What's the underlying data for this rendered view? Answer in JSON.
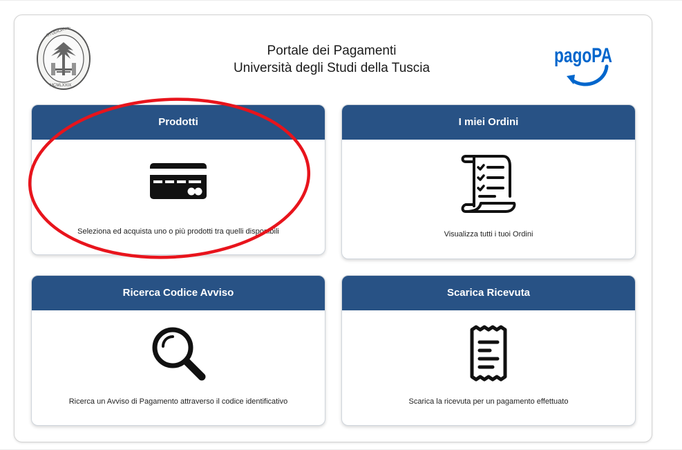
{
  "header": {
    "title_line1": "Portale dei Pagamenti",
    "title_line2": "Università degli Studi della Tuscia",
    "seal_text_top": "UNIVERSITAS STUDIORUM TUSCIAE",
    "seal_text_bottom": "VITERBIUM MCMLXXIX",
    "pagopa_logo_text": "pagoPA"
  },
  "cards": [
    {
      "title": "Prodotti",
      "icon": "credit-card-icon",
      "description": "Seleziona ed acquista uno o più prodotti tra quelli disponibili"
    },
    {
      "title": "I miei Ordini",
      "icon": "checklist-scroll-icon",
      "description": "Visualizza tutti i tuoi Ordini"
    },
    {
      "title": "Ricerca Codice Avviso",
      "icon": "magnifier-icon",
      "description": "Ricerca un Avviso di Pagamento attraverso il codice identificativo"
    },
    {
      "title": "Scarica Ricevuta",
      "icon": "receipt-icon",
      "description": "Scarica la ricevuta per un pagamento effettuato"
    }
  ],
  "colors": {
    "card_header": "#285285",
    "pagopa_blue": "#0066cc",
    "annotation_red": "#e8141c"
  }
}
